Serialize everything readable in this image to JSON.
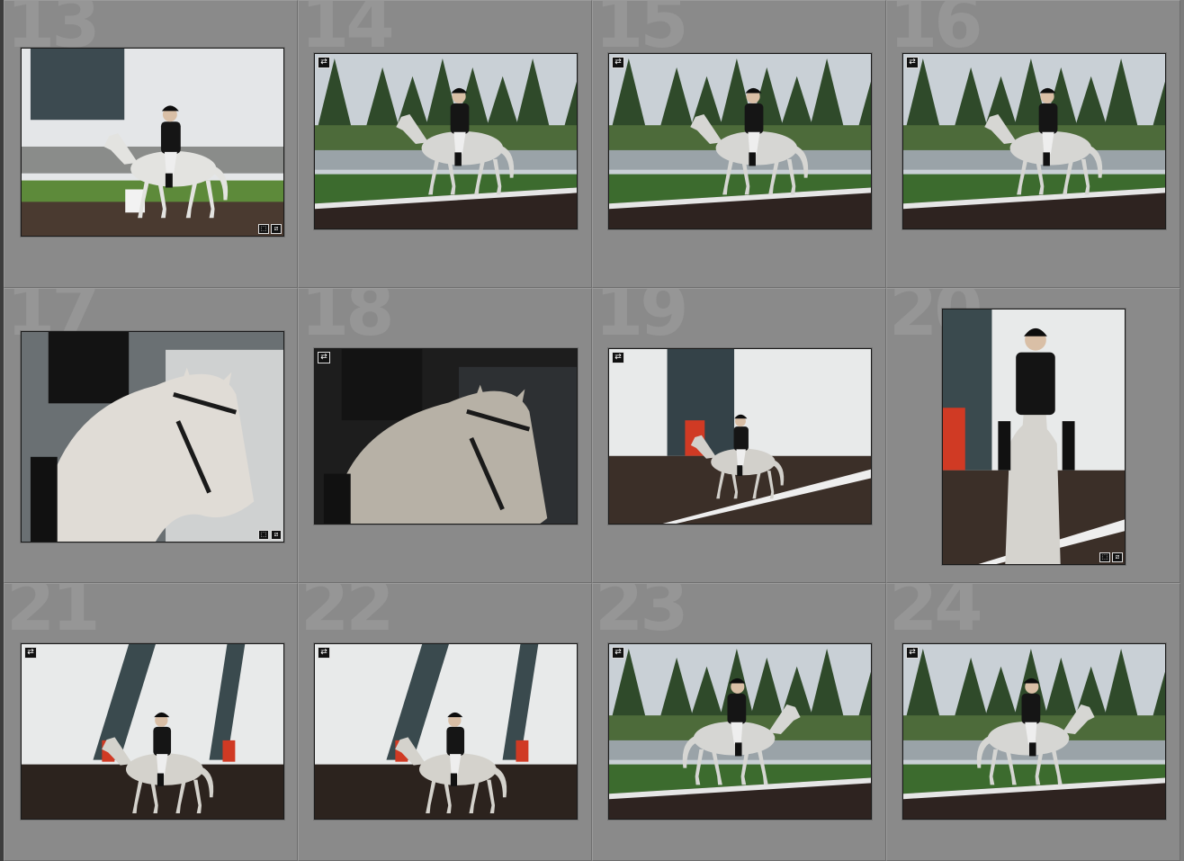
{
  "grid": {
    "cells": [
      {
        "index": "13",
        "orientation": "landscape",
        "scene": "arena-white",
        "badges": [
          "crop-icon",
          "edit-icon"
        ],
        "sync": false
      },
      {
        "index": "14",
        "orientation": "landscape",
        "scene": "trees",
        "badges": [],
        "sync": true
      },
      {
        "index": "15",
        "orientation": "landscape",
        "scene": "trees",
        "badges": [],
        "sync": true
      },
      {
        "index": "16",
        "orientation": "landscape",
        "scene": "trees",
        "badges": [],
        "sync": true
      },
      {
        "index": "17",
        "orientation": "landscape",
        "scene": "closeup",
        "badges": [
          "crop-icon",
          "edit-icon"
        ],
        "sync": false
      },
      {
        "index": "18",
        "orientation": "landscape",
        "scene": "closeup-dark",
        "badges": [],
        "sync": true
      },
      {
        "index": "19",
        "orientation": "landscape",
        "scene": "barn",
        "badges": [],
        "sync": true
      },
      {
        "index": "20",
        "orientation": "portrait",
        "scene": "portrait",
        "badges": [
          "crop-icon",
          "edit-icon"
        ],
        "sync": false
      },
      {
        "index": "21",
        "orientation": "landscape",
        "scene": "barn-front",
        "badges": [],
        "sync": true
      },
      {
        "index": "22",
        "orientation": "landscape",
        "scene": "barn-front",
        "badges": [],
        "sync": true
      },
      {
        "index": "23",
        "orientation": "landscape",
        "scene": "trees-right",
        "badges": [],
        "sync": true
      },
      {
        "index": "24",
        "orientation": "landscape",
        "scene": "trees-right",
        "badges": [],
        "sync": true
      }
    ],
    "sync_glyph": "⇄",
    "crop_glyph": "⬚",
    "edit_glyph": "⧄"
  },
  "colors": {
    "cell_bg": "#8a8a8a",
    "index_text": "#969696",
    "thumb_border": "#1a1a1a"
  }
}
